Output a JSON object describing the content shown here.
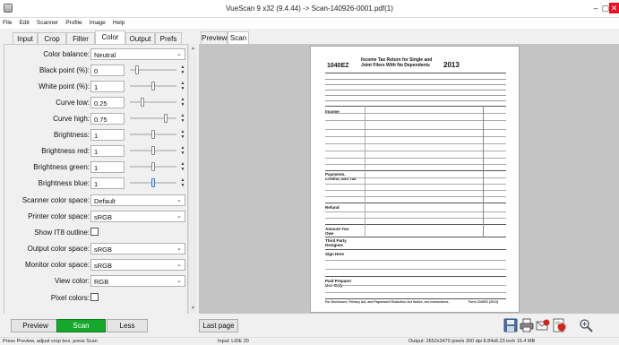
{
  "window": {
    "title": "VueScan 9 x32 (9.4.44) -> Scan-140926-0001.pdf(1)",
    "controls": [
      "–",
      "▢",
      "✕"
    ]
  },
  "menu": [
    "File",
    "Edit",
    "Scanner",
    "Profile",
    "Image",
    "Help"
  ],
  "left_tabs": [
    "Input",
    "Crop",
    "Filter",
    "Color",
    "Output",
    "Prefs"
  ],
  "active_left_tab": "Color",
  "color_settings": {
    "color_balance": {
      "label": "Color balance:",
      "value": "Neutral"
    },
    "black_point": {
      "label": "Black point (%):",
      "value": "0"
    },
    "white_point": {
      "label": "White point (%):",
      "value": "1"
    },
    "curve_low": {
      "label": "Curve low:",
      "value": "0.25"
    },
    "curve_high": {
      "label": "Curve high:",
      "value": "0.75"
    },
    "brightness": {
      "label": "Brightness:",
      "value": "1"
    },
    "brightness_red": {
      "label": "Brightness red:",
      "value": "1"
    },
    "brightness_green": {
      "label": "Brightness green:",
      "value": "1"
    },
    "brightness_blue": {
      "label": "Brightness blue:",
      "value": "1"
    },
    "scanner_color_space": {
      "label": "Scanner color space:",
      "value": "Default"
    },
    "printer_color_space": {
      "label": "Printer color space:",
      "value": "sRGB"
    },
    "show_it8_outline": {
      "label": "Show IT8 outline:",
      "checked": false
    },
    "output_color_space": {
      "label": "Output color space:",
      "value": "sRGB"
    },
    "monitor_color_space": {
      "label": "Monitor color space:",
      "value": "sRGB"
    },
    "view_color": {
      "label": "View color:",
      "value": "RGB"
    },
    "pixel_colors": {
      "label": "Pixel colors:",
      "checked": false
    }
  },
  "right_tabs": [
    "Preview",
    "Scan"
  ],
  "active_right_tab": "Scan",
  "document": {
    "form_number": "1040EZ",
    "heading_line1": "Income Tax Return for Single and",
    "heading_line2": "Joint Filers With No Dependents",
    "year": "2013",
    "section_labels": [
      "Income",
      "Payments, Credits, and Tax",
      "Refund",
      "Amount You Owe",
      "Third Party Designee",
      "Sign Here",
      "Paid Preparer Use Only"
    ],
    "footer_left": "For Disclosure, Privacy Act, and Paperwork Reduction Act Notice, see instructions.",
    "footer_right": "Form 1040EZ (2013)"
  },
  "bottom_buttons": {
    "preview": "Preview",
    "scan": "Scan",
    "less": "Less",
    "last_page": "Last page"
  },
  "toolbar_icons": [
    "save-icon",
    "print-icon",
    "email-icon",
    "pdf-icon",
    "zoom-icon"
  ],
  "status": {
    "left": "Press Preview, adjust crop box, press Scan",
    "middle": "Input: LiDE 20",
    "right": "Output: 2652x3470 pixels 300 dpi 8.84x8.23 inch 15.4 MB"
  },
  "colors": {
    "scan_button": "#16a82c",
    "close_button": "#e81123",
    "preview_bg": "#c4c4c4"
  }
}
